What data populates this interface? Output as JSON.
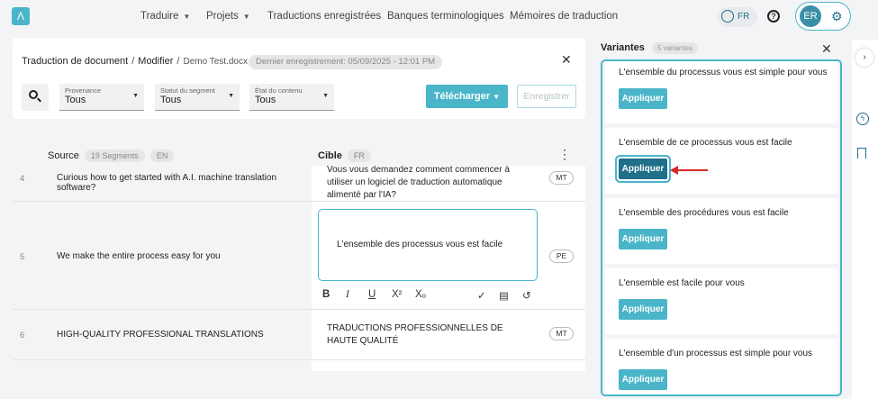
{
  "nav": {
    "logo": "Λ",
    "items": [
      "Traduire",
      "Projets",
      "Traductions enregistrées",
      "Banques terminologiques",
      "Mémoires de traduction"
    ],
    "lang": "FR",
    "help": "?",
    "user_initials": "ER",
    "gear": "⚙"
  },
  "doc": {
    "crumb1": "Traduction de document",
    "crumb2": "Modifier",
    "file": "Demo Test.docx",
    "sep": "/",
    "last_saved": "Dernier enregistrement: 05/09/2025 - 12:01 PM",
    "close": "✕"
  },
  "filters": [
    {
      "label": "Provenance",
      "value": "Tous"
    },
    {
      "label": "Statut du segment",
      "value": "Tous"
    },
    {
      "label": "État du contenu",
      "value": "Tous"
    }
  ],
  "actions": {
    "download": "Télécharger",
    "save": "Enregistrer"
  },
  "table": {
    "source_label": "Source",
    "segments": "19 Segments",
    "source_lang": "EN",
    "target_label": "Cible",
    "target_lang": "FR",
    "rows": [
      {
        "num": "4",
        "source": "Curious how to get started with A.I. machine translation software?",
        "target": "Vous vous demandez comment commencer à utiliser un logiciel de traduction automatique alimenté par l'IA?",
        "tag": "MT"
      },
      {
        "num": "5",
        "source": "We make the entire process easy for you",
        "target": "L'ensemble des processus vous est facile",
        "tag": "PE"
      },
      {
        "num": "6",
        "source": "HIGH-QUALITY PROFESSIONAL TRANSLATIONS",
        "target": "TRADUCTIONS PROFESSIONNELLES DE HAUTE QUALITÉ",
        "tag": "MT"
      }
    ]
  },
  "editor_toolbar": [
    "B",
    "I",
    "U",
    "X²",
    "Xₒ",
    "✓",
    "▤",
    "↺"
  ],
  "variants": {
    "title": "Variantes",
    "count": "5 variantes",
    "close": "✕",
    "apply_label": "Appliquer",
    "items": [
      "L'ensemble du processus vous est simple pour vous",
      "L'ensemble de ce processus vous est facile",
      "L'ensemble des procédures vous est facile",
      "L'ensemble est facile pour vous",
      "L'ensemble d'un processus est simple pour vous"
    ]
  },
  "rail": {
    "expand": "›",
    "bolt": "ϟ"
  },
  "colors": {
    "accent": "#4ab5c9",
    "accent_dark": "#1f6f8b",
    "arrow": "#d62828"
  }
}
